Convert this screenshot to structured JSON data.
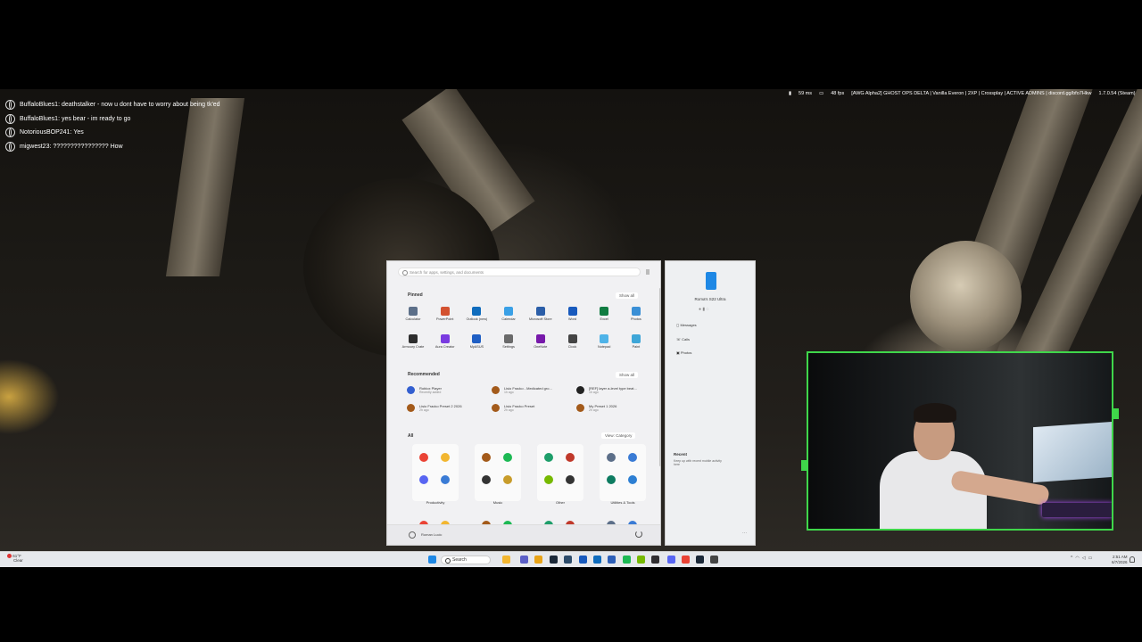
{
  "chat": [
    {
      "user": "BuffaloBlues1",
      "message": "deathstalker - now u dont have to worry about being tk'ed"
    },
    {
      "user": "BuffaloBlues1",
      "message": "yes bear - im ready to go"
    },
    {
      "user": "NotoriousBOP241",
      "message": "Yes"
    },
    {
      "user": "migwest23",
      "message": "???????????????? How"
    }
  ],
  "server_bar": {
    "ping": "59 ms",
    "fps": "48 fps",
    "server": "[AWG Alpha2] GHOST OPS DELTA | Vanilla Everon | 2XP | Crossplay | ACTIVE ADMINS | discord.gg/bfo7Hkw",
    "version": "1.7.0.54 (Steam)"
  },
  "start_menu": {
    "search_placeholder": "Search for apps, settings, and documents",
    "pinned_title": "Pinned",
    "show_all": "Show all",
    "pinned": [
      {
        "label": "Calculator",
        "color": "#5c6f89"
      },
      {
        "label": "PowerPoint",
        "color": "#d35230"
      },
      {
        "label": "Outlook (new)",
        "color": "#0f6cbd"
      },
      {
        "label": "Calendar",
        "color": "#3aa0e6"
      },
      {
        "label": "Microsoft Store",
        "color": "#2b5ea8"
      },
      {
        "label": "Word",
        "color": "#185abd"
      },
      {
        "label": "Excel",
        "color": "#107c41"
      },
      {
        "label": "Photos",
        "color": "#3a8fd6"
      },
      {
        "label": "Armoury Crate",
        "color": "#2d2d2d"
      },
      {
        "label": "Aura Creator",
        "color": "#7a3be0"
      },
      {
        "label": "MyASUS",
        "color": "#1f5fc4"
      },
      {
        "label": "Settings",
        "color": "#6a6a6a"
      },
      {
        "label": "OneNote",
        "color": "#7719aa"
      },
      {
        "label": "Clock",
        "color": "#444"
      },
      {
        "label": "Notepad",
        "color": "#4fb3e8"
      },
      {
        "label": "Paint",
        "color": "#3ea6d8"
      }
    ],
    "recommended_title": "Recommended",
    "recommended": [
      {
        "name": "Roblox Player",
        "sub": "Recently added",
        "color": "#335fd0"
      },
      {
        "name": "Lisio Fracko - Medicated gro...",
        "sub": "1h ago",
        "color": "#a35a1a"
      },
      {
        "name": "[REF] layer a-level type beat...",
        "sub": "1h ago",
        "color": "#222"
      },
      {
        "name": "Lisio Fracko Preset 2 2026",
        "sub": "2h ago",
        "color": "#a35a1a"
      },
      {
        "name": "Lisio Fracko Preset",
        "sub": "2h ago",
        "color": "#a35a1a"
      },
      {
        "name": "My Preset 1 2026",
        "sub": "2h ago",
        "color": "#a35a1a"
      }
    ],
    "all_title": "All",
    "view": "View: Category",
    "categories": [
      {
        "label": "Productivity",
        "icons": [
          "#ea4335",
          "#f2b630",
          "#5865f2",
          "#3a7bd5"
        ]
      },
      {
        "label": "Music",
        "icons": [
          "#a35a1a",
          "#1db954",
          "#333",
          "#c89c2a"
        ]
      },
      {
        "label": "Other",
        "icons": [
          "#1e9e6a",
          "#c0392b",
          "#76b900",
          "#333"
        ]
      },
      {
        "label": "Utilities & Tools",
        "icons": [
          "#5c6f89",
          "#3a7bd5",
          "#0e7c61",
          "#2d7fd3"
        ]
      }
    ],
    "user_name": "Roman Lucic"
  },
  "phone_link": {
    "device": "Roma's S22 Ultra",
    "items": [
      "Messages",
      "Calls",
      "Photos"
    ],
    "recent_title": "Recent",
    "recent_text": "Keep up with recent mobile activity here"
  },
  "taskbar": {
    "weather_temp": "61°F",
    "weather_desc": "Clear",
    "search_label": "Search",
    "time": "2:51 AM",
    "date": "6/7/2026",
    "icons": [
      {
        "name": "start-icon",
        "color": "#1e88e5"
      },
      {
        "name": "file-explorer-icon",
        "color": "#f2b630"
      },
      {
        "name": "teams-icon",
        "color": "#5b5fc7"
      },
      {
        "name": "folder-icon",
        "color": "#e8a317"
      },
      {
        "name": "steam-icon",
        "color": "#1b2838"
      },
      {
        "name": "arma-icon",
        "color": "#2d4c6b"
      },
      {
        "name": "word-icon",
        "color": "#185abd"
      },
      {
        "name": "outlook-icon",
        "color": "#0f6cbd"
      },
      {
        "name": "malwarebytes-icon",
        "color": "#2d5fb8"
      },
      {
        "name": "spotify-icon",
        "color": "#1db954"
      },
      {
        "name": "nvidia-icon",
        "color": "#76b900"
      },
      {
        "name": "obs-icon",
        "color": "#302e31"
      },
      {
        "name": "discord-icon",
        "color": "#5865f2"
      },
      {
        "name": "chrome-icon",
        "color": "#ea4335"
      },
      {
        "name": "steam-client-icon",
        "color": "#1b2838"
      },
      {
        "name": "app-icon",
        "color": "#444"
      }
    ]
  }
}
